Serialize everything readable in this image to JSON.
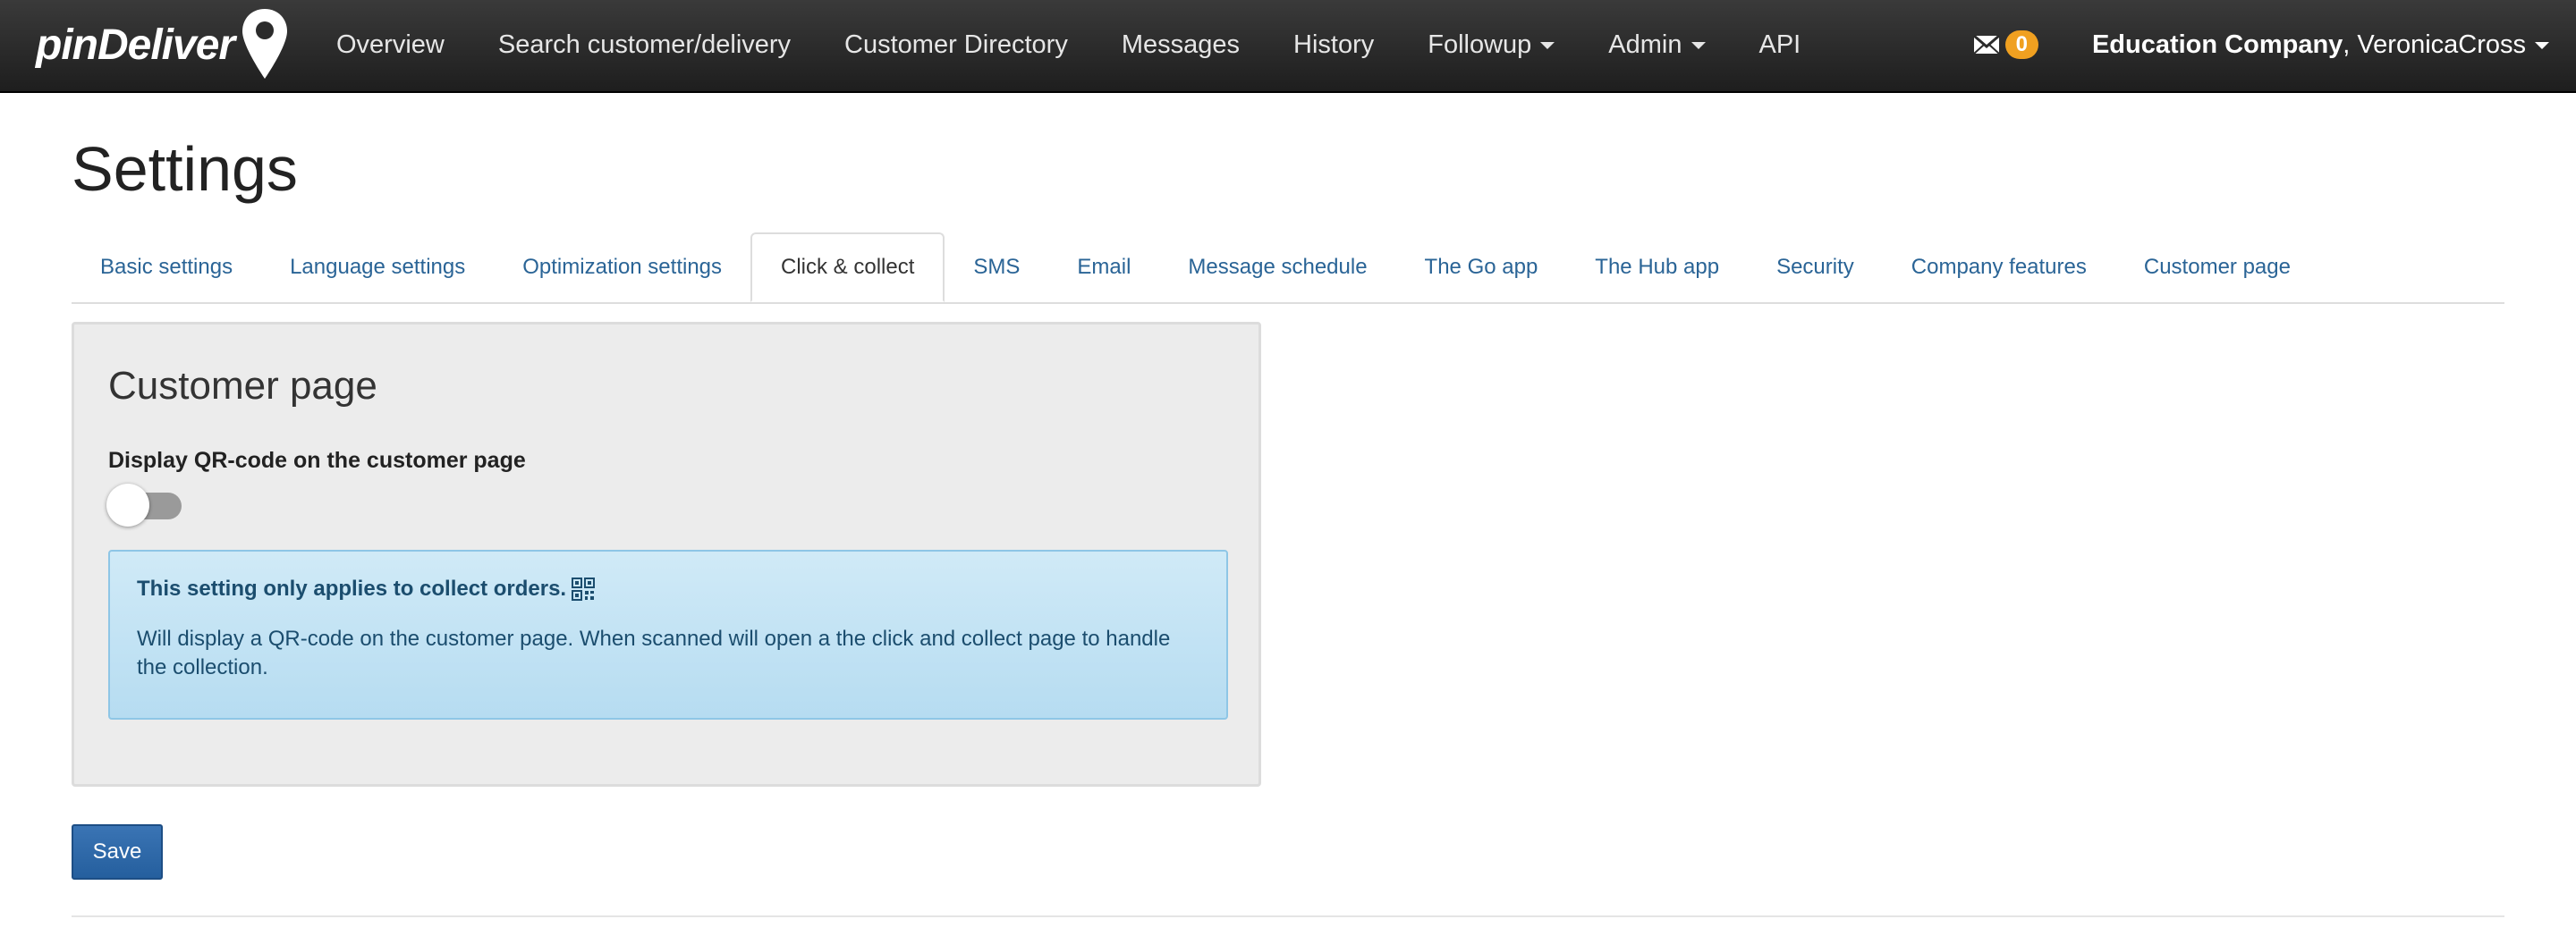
{
  "brand": {
    "name": "pinDeliver"
  },
  "nav": {
    "items": [
      {
        "label": "Overview",
        "dropdown": false
      },
      {
        "label": "Search customer/delivery",
        "dropdown": false
      },
      {
        "label": "Customer Directory",
        "dropdown": false
      },
      {
        "label": "Messages",
        "dropdown": false
      },
      {
        "label": "History",
        "dropdown": false
      },
      {
        "label": "Followup",
        "dropdown": true
      },
      {
        "label": "Admin",
        "dropdown": true
      },
      {
        "label": "API",
        "dropdown": false
      }
    ],
    "messages_count": "0",
    "company": "Education Company",
    "user": ", VeronicaCross"
  },
  "page": {
    "title": "Settings"
  },
  "tabs": [
    {
      "label": "Basic settings",
      "active": false
    },
    {
      "label": "Language settings",
      "active": false
    },
    {
      "label": "Optimization settings",
      "active": false
    },
    {
      "label": "Click & collect",
      "active": true
    },
    {
      "label": "SMS",
      "active": false
    },
    {
      "label": "Email",
      "active": false
    },
    {
      "label": "Message schedule",
      "active": false
    },
    {
      "label": "The Go app",
      "active": false
    },
    {
      "label": "The Hub app",
      "active": false
    },
    {
      "label": "Security",
      "active": false
    },
    {
      "label": "Company features",
      "active": false
    },
    {
      "label": "Customer page",
      "active": false
    }
  ],
  "panel": {
    "title": "Customer page",
    "qr_label": "Display QR-code on the customer page",
    "qr_enabled": false,
    "alert_head": "This setting only applies to collect orders.",
    "alert_body": "Will display a QR-code on the customer page. When scanned will open a the click and collect page to handle the collection."
  },
  "actions": {
    "save": "Save"
  },
  "colors": {
    "navbar": "#2b2b2b",
    "link": "#2a6496",
    "badge": "#f0a020",
    "save": "#2d6aa8",
    "alert_bg": "#c4e3f3"
  }
}
